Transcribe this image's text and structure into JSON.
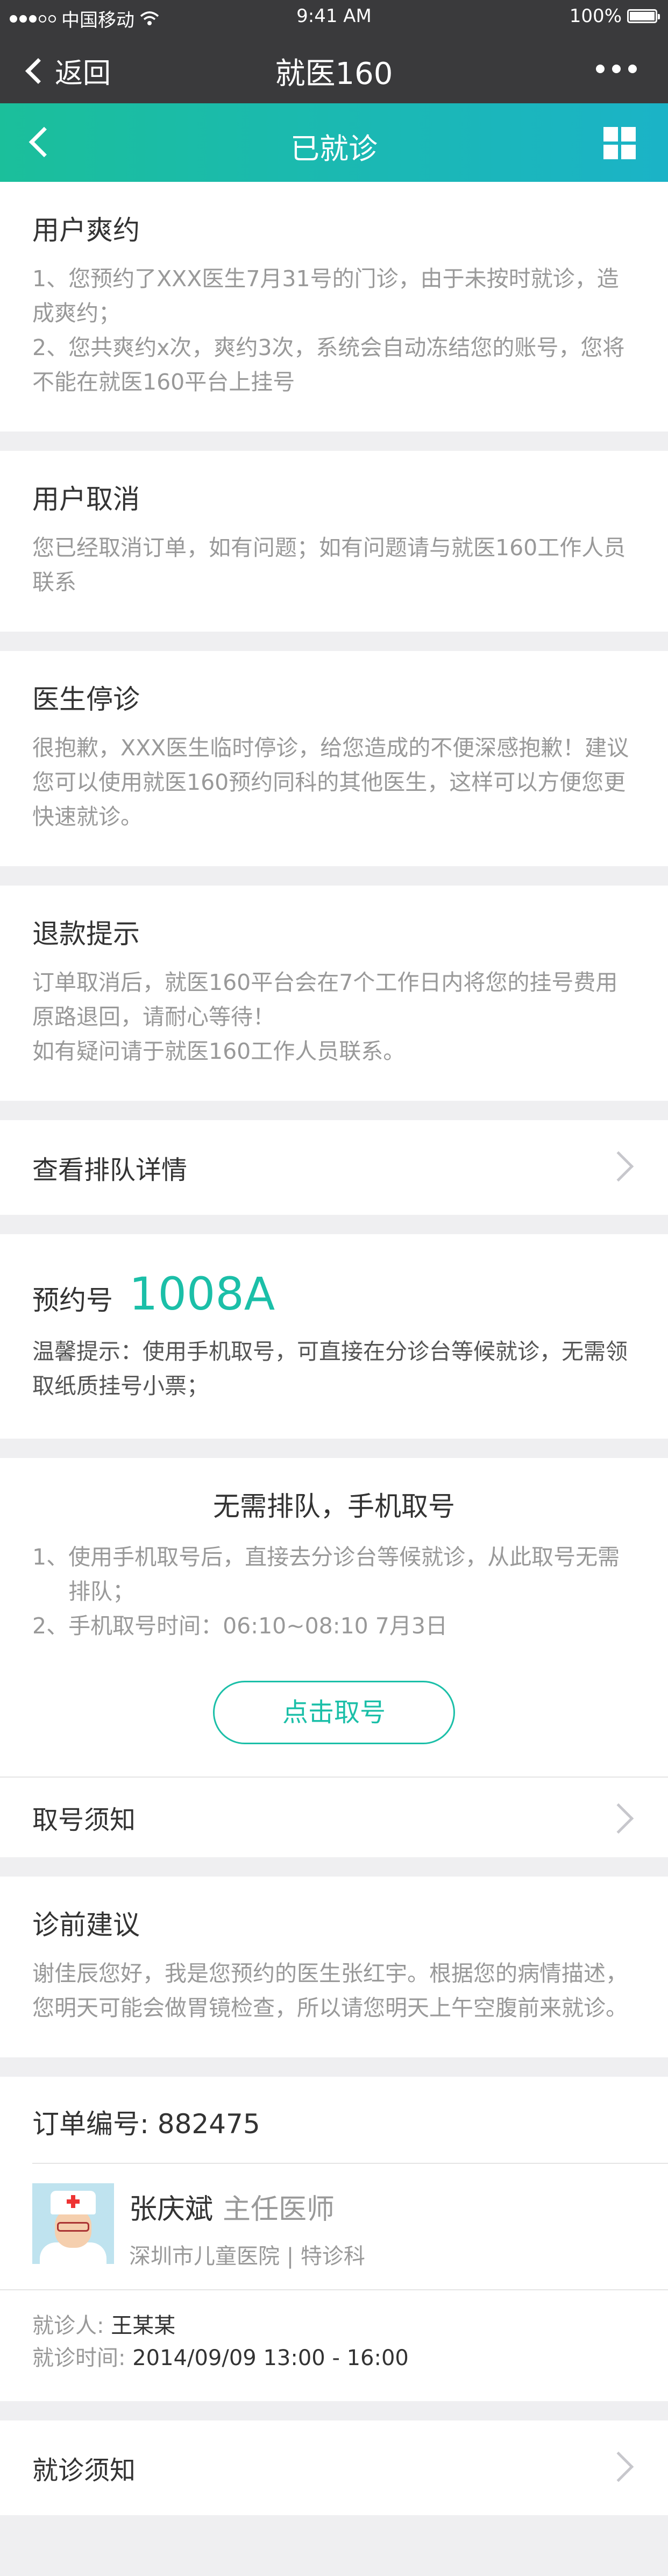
{
  "status_bar": {
    "carrier": "中国移动",
    "time": "9:41 AM",
    "battery": "100%",
    "battery_level": 1.0
  },
  "top_nav": {
    "back_label": "返回",
    "title": "就医160",
    "more_icon": "more-dots-icon"
  },
  "page_nav": {
    "back_icon": "chevron-left-icon",
    "title": "已就诊",
    "menu_icon": "grid-icon"
  },
  "notices": [
    {
      "title": "用户爽约",
      "lines": [
        "1、您预约了XXX医生7月31号的门诊，由于未按时就诊，造成爽约；",
        "2、您共爽约x次，爽约3次，系统会自动冻结您的账号，您将不能在就医160平台上挂号"
      ]
    },
    {
      "title": "用户取消",
      "lines": [
        "您已经取消订单，如有问题；如有问题请与就医160工作人员联系"
      ]
    },
    {
      "title": "医生停诊",
      "lines": [
        "很抱歉，XXX医生临时停诊，给您造成的不便深感抱歉！建议您可以使用就医160预约同科的其他医生，这样可以方便您更快速就诊。"
      ]
    },
    {
      "title": "退款提示",
      "lines": [
        "订单取消后，就医160平台会在7个工作日内将您的挂号费用原路退回，请耐心等待！",
        "如有疑问请于就医160工作人员联系。"
      ]
    }
  ],
  "queue_detail_row": "查看排队详情",
  "reservation": {
    "label": "预约号",
    "number": "1008A",
    "tip": "温馨提示：使用手机取号，可直接在分诊台等候就诊，无需领取纸质挂号小票；"
  },
  "mobile_ticket": {
    "title": "无需排队，手机取号",
    "items": [
      {
        "idx": "1、",
        "text": "使用手机取号后，直接去分诊台等候就诊，从此取号无需排队；"
      },
      {
        "idx": "2、",
        "text": "手机取号时间：06:10~08:10  7月3日"
      }
    ],
    "button_label": "点击取号",
    "notice_row": "取号须知"
  },
  "pre_visit": {
    "title": "诊前建议",
    "text": "谢佳辰您好，我是您预约的医生张红宇。根据您的病情描述，您明天可能会做胃镜检查，所以请您明天上午空腹前来就诊。"
  },
  "order": {
    "number_label": "订单编号:",
    "number": "882475",
    "doctor_name": "张庆斌",
    "doctor_title": "主任医师",
    "hospital": "深圳市儿童医院 | 特诊科",
    "patient_label": "就诊人:",
    "patient": "王某某",
    "time_label": "就诊时间:",
    "time": "2014/09/09  13:00 - 16:00"
  },
  "visit_notice_row": "就诊须知"
}
